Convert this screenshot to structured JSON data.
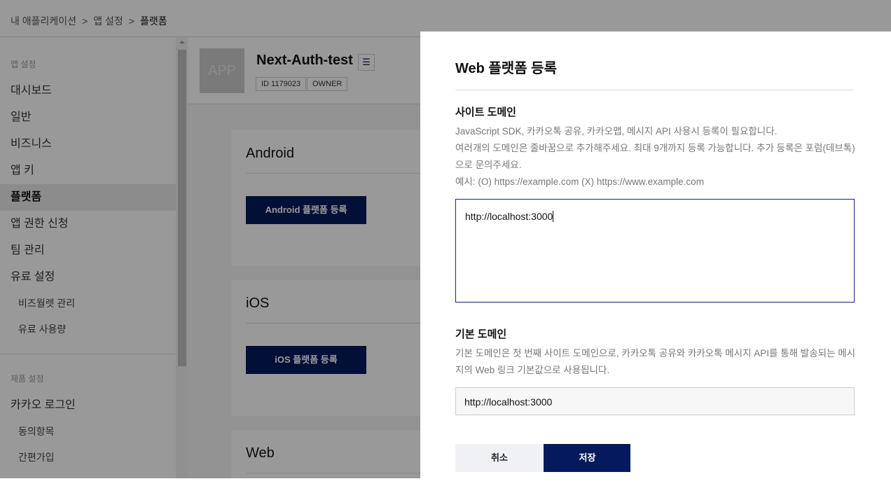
{
  "breadcrumb": [
    "내 애플리케이션",
    "앱 설정",
    "플랫폼"
  ],
  "breadcrumb_sep": ">",
  "sidebar": {
    "group1": "앱 설정",
    "items": [
      "대시보드",
      "일반",
      "비즈니스",
      "앱 키",
      "플랫폼",
      "앱 권한 신청",
      "팀 관리",
      "유료 설정"
    ],
    "subitems": [
      "비즈월렛 관리",
      "유료 사용량"
    ],
    "group2": "제품 설정",
    "items2": [
      "카카오 로그인"
    ],
    "subitems2": [
      "동의항목",
      "간편가입"
    ]
  },
  "app": {
    "image_text": "APP",
    "name": "Next-Auth-test",
    "id": "ID 1179023",
    "role": "OWNER"
  },
  "sections": [
    {
      "title": "Android",
      "button": "Android 플랫폼 등록"
    },
    {
      "title": "iOS",
      "button": "iOS 플랫폼 등록"
    },
    {
      "title": "Web"
    }
  ],
  "modal": {
    "title": "Web 플랫폼 등록",
    "site_domain_label": "사이트 도메인",
    "site_desc": [
      "JavaScript SDK, 카카오톡 공유, 카카오맵, 메시지 API 사용시 등록이 필요합니다.",
      "여러개의 도메인은 줄바꿈으로 추가해주세요. 최대 9개까지 등록 가능합니다. 추가 등록은 포럼(데브톡)으로 문의주세요.",
      "예시: (O) https://example.com (X) https://www.example.com"
    ],
    "site_domain_value": "http://localhost:3000",
    "default_domain_label": "기본 도메인",
    "default_desc": "기본 도메인은 첫 번째 사이트 도메인으로, 카카오톡 공유와 카카오톡 메시지 API를 통해 발송되는 메시지의 Web 링크 기본값으로 사용됩니다.",
    "default_domain_value": "http://localhost:3000",
    "cancel": "취소",
    "save": "저장"
  }
}
